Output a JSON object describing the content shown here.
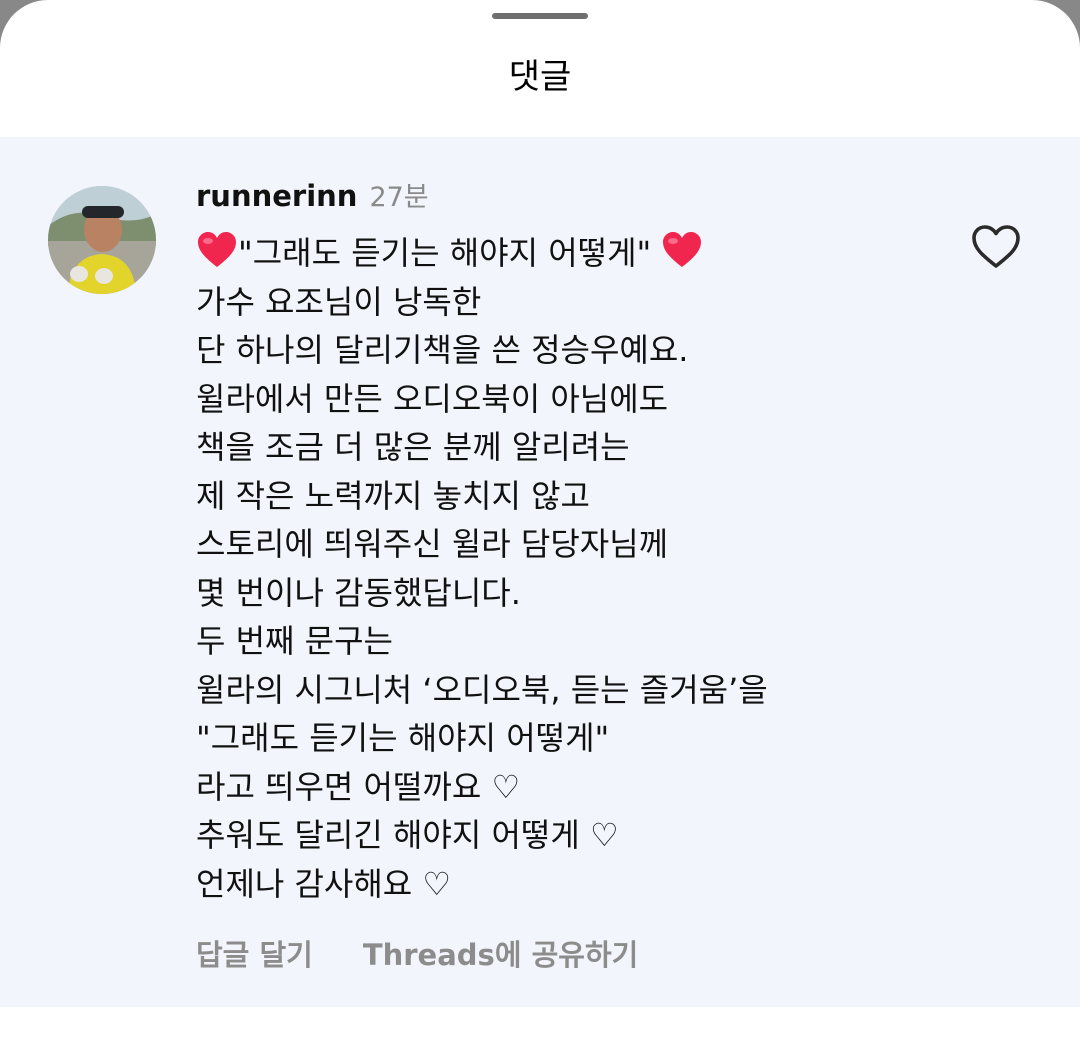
{
  "sheet": {
    "title": "댓글"
  },
  "comment": {
    "username": "runnerinn",
    "time": "27분",
    "first_line_text": "\"그래도 듣기는 해야지 어떻게\"",
    "lines": [
      "가수 요조님이 낭독한",
      "단 하나의 달리기책을 쓴 정승우예요.",
      "윌라에서 만든 오디오북이 아님에도",
      "책을 조금 더 많은 분께 알리려는",
      "제 작은 노력까지 놓치지 않고",
      "스토리에 띄워주신 윌라 담당자님께",
      "몇 번이나 감동했답니다.",
      "두 번째 문구는",
      "윌라의 시그니처 ‘오디오북, 듣는 즐거움’을",
      "\"그래도 듣기는 해야지 어떻게\"",
      "라고 띄우면 어떨까요 ♡",
      "추워도 달리긴 해야지 어떻게 ♡",
      "언제나 감사해요 ♡"
    ],
    "reply_label": "답글 달기",
    "share_label": "Threads에 공유하기"
  },
  "icons": {
    "heart_emoji": "red-heart-emoji",
    "like": "heart-outline-icon"
  },
  "colors": {
    "panel_background": "#f2f6fc",
    "heart_emoji": "#f0264f",
    "secondary_text": "#8c8c8c"
  }
}
